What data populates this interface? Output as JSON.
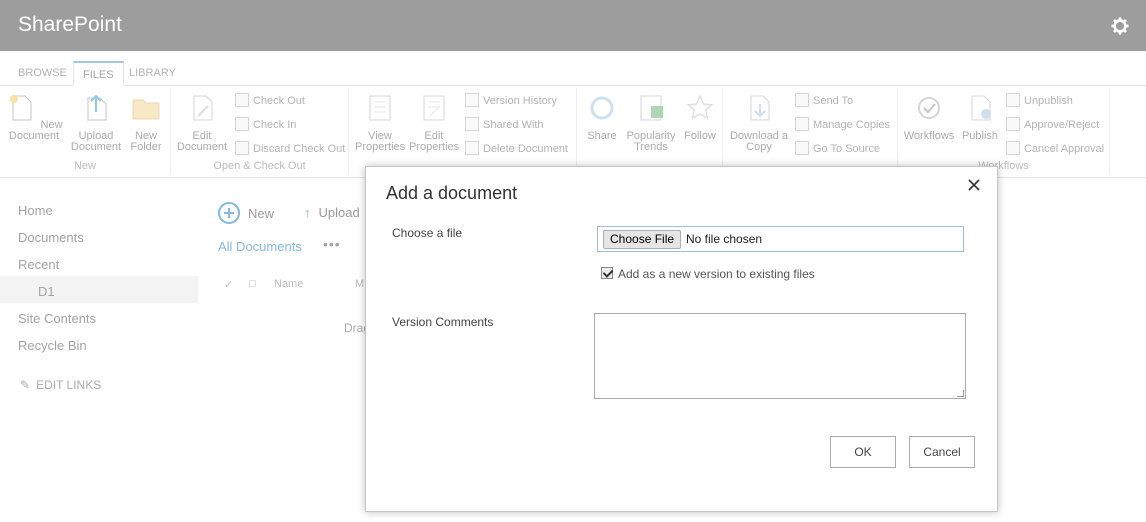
{
  "suite": {
    "title": "SharePoint",
    "settings_icon": "gear-icon"
  },
  "tabs": [
    {
      "label": "BROWSE"
    },
    {
      "label": "FILES"
    },
    {
      "label": "LIBRARY"
    }
  ],
  "ribbon": {
    "new_group": {
      "label": "New",
      "new_document": "New Document",
      "upload_document": "Upload Document",
      "new_folder": "New Folder"
    },
    "open_group": {
      "label": "Open & Check Out",
      "edit_document": "Edit Document",
      "check_out": "Check Out",
      "check_in": "Check In",
      "discard_check_out": "Discard Check Out"
    },
    "manage_group": {
      "view_properties": "View Properties",
      "edit_properties": "Edit Properties",
      "version_history": "Version History",
      "shared_with": "Shared With",
      "delete_document": "Delete Document"
    },
    "share_group": {
      "share": "Share",
      "popularity_trends": "Popularity Trends",
      "follow": "Follow"
    },
    "copies_group": {
      "download_copy": "Download a Copy",
      "send_to": "Send To",
      "manage_copies": "Manage Copies",
      "go_to_source": "Go To Source"
    },
    "workflows_group": {
      "label": "Workflows",
      "workflows": "Workflows",
      "publish": "Publish",
      "unpublish": "Unpublish",
      "approve_reject": "Approve/Reject",
      "cancel_approval": "Cancel Approval"
    }
  },
  "leftnav": {
    "items": [
      "Home",
      "Documents",
      "Recent",
      "D1",
      "Site Contents",
      "Recycle Bin"
    ],
    "edit_links": "EDIT LINKS"
  },
  "main": {
    "new_label": "New",
    "upload_label": "Upload",
    "view_label": "All Documents",
    "more": "•••",
    "col_name": "Name",
    "col_modified": "M",
    "drag_text": "Drag"
  },
  "dialog": {
    "title": "Add a document",
    "close_icon": "close-icon",
    "choose_label": "Choose a file",
    "choose_button": "Choose File",
    "no_file": "No file chosen",
    "add_version_label": "Add as a new version to existing files",
    "add_version_checked": true,
    "comments_label": "Version Comments",
    "ok": "OK",
    "cancel": "Cancel"
  }
}
